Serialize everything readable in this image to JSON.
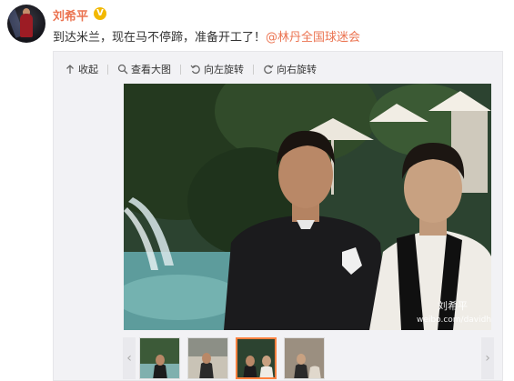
{
  "post": {
    "author": "刘希平",
    "verified_badge": "V",
    "text_main": "到达米兰，现在马不停蹄，准备开工了！",
    "mention": "@林丹全国球迷会"
  },
  "toolbar": {
    "collapse": "收起",
    "view_large": "查看大图",
    "rotate_left": "向左旋转",
    "rotate_right": "向右旋转"
  },
  "photo": {
    "watermark_handle": "刘希平",
    "watermark_url": "weibo.com/davidhliu"
  },
  "thumbnails": {
    "count": 4,
    "active_index": 2
  },
  "colors": {
    "author": "#eb7350",
    "mention": "#eb7350",
    "badge": "#f2b800",
    "thumb_active": "#ff8140"
  }
}
